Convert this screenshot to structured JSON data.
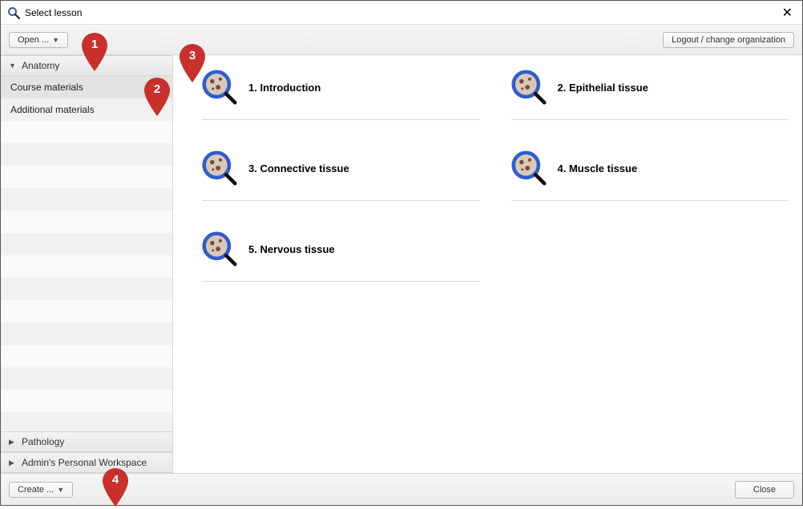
{
  "window": {
    "title": "Select lesson"
  },
  "toolbar": {
    "open_label": "Open ...",
    "logout_label": "Logout / change organization"
  },
  "sidebar": {
    "sections": [
      {
        "label": "Anatomy",
        "expanded": true,
        "items": [
          {
            "label": "Course materials",
            "selected": true
          },
          {
            "label": "Additional materials",
            "selected": false
          }
        ]
      },
      {
        "label": "Pathology",
        "expanded": false,
        "items": []
      },
      {
        "label": "Admin's Personal Workspace",
        "expanded": false,
        "items": []
      }
    ]
  },
  "lessons": [
    {
      "title": "1. Introduction"
    },
    {
      "title": "2. Epithelial tissue"
    },
    {
      "title": "3. Connective tissue"
    },
    {
      "title": "4. Muscle tissue"
    },
    {
      "title": "5. Nervous tissue"
    }
  ],
  "footer": {
    "create_label": "Create ...",
    "close_label": "Close"
  },
  "pins": {
    "p1": "1",
    "p2": "2",
    "p3": "3",
    "p4": "4"
  }
}
